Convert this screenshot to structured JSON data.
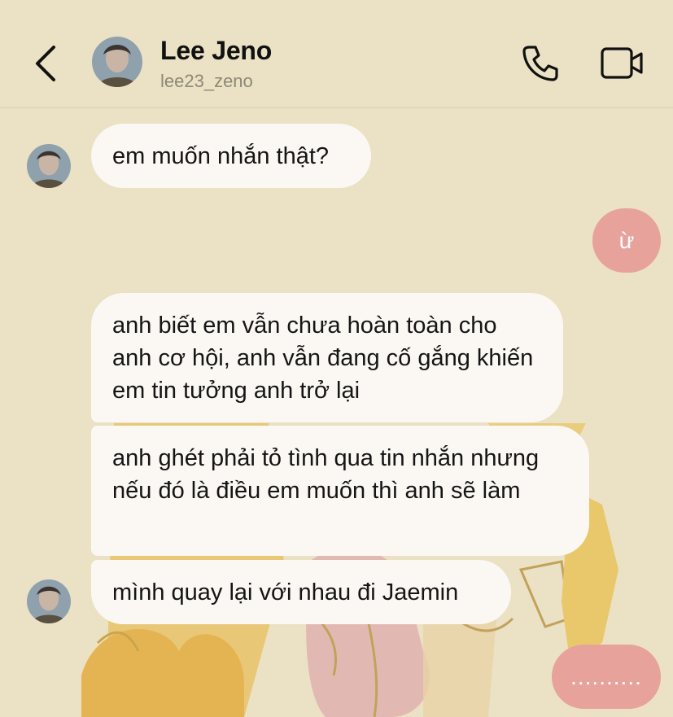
{
  "header": {
    "contact_name": "Lee Jeno",
    "username": "lee23_zeno"
  },
  "icons": {
    "back": "chevron-left-icon",
    "call": "phone-icon",
    "video": "video-camera-icon"
  },
  "messages": [
    {
      "direction": "received",
      "text": "em muốn nhắn thật?"
    },
    {
      "direction": "sent",
      "text": "ừ"
    },
    {
      "direction": "received",
      "text": "anh biết em vẫn chưa hoàn toàn cho anh cơ hội, anh vẫn đang cố gắng khiến em tin tưởng anh trở lại"
    },
    {
      "direction": "received",
      "text": "anh ghét phải tỏ tình qua tin nhắn nhưng nếu đó là điều em muốn thì anh sẽ làm"
    },
    {
      "direction": "received",
      "text": "mình quay lại với nhau đi Jaemin"
    },
    {
      "direction": "sent",
      "text": ".........."
    }
  ],
  "colors": {
    "background": "#ebe1c4",
    "received_bubble": "#fbf8f3",
    "sent_bubble": "#e6a29b"
  }
}
